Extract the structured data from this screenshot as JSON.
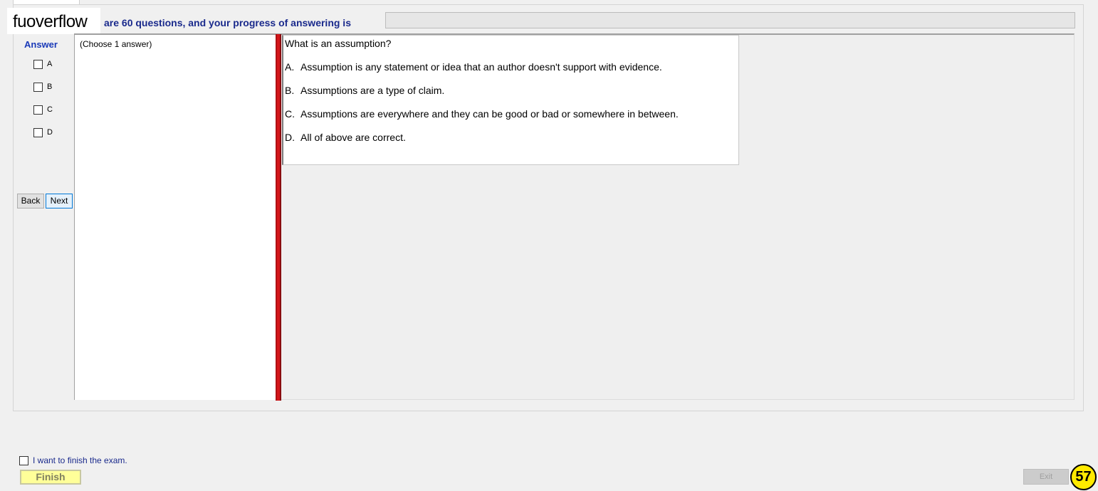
{
  "brand": {
    "text": "fuoverflow"
  },
  "header": {
    "progress_text": "are 60 questions, and your progress of answering is"
  },
  "progress": {
    "value": 0
  },
  "answer_panel": {
    "heading": "Answer",
    "options": [
      {
        "letter": "A",
        "checked": false
      },
      {
        "letter": "B",
        "checked": false
      },
      {
        "letter": "C",
        "checked": false
      },
      {
        "letter": "D",
        "checked": false
      }
    ],
    "back_label": "Back",
    "next_label": "Next"
  },
  "instruction": {
    "text": "(Choose 1 answer)"
  },
  "question": {
    "text": "What is an assumption?",
    "choices": [
      {
        "letter": "A.",
        "text": "Assumption is any statement or idea that an author doesn't support with evidence."
      },
      {
        "letter": "B.",
        "text": "Assumptions are a type of claim."
      },
      {
        "letter": "C.",
        "text": "Assumptions are everywhere and they can be good or bad or somewhere in between."
      },
      {
        "letter": "D.",
        "text": "All of above are correct."
      }
    ]
  },
  "footer": {
    "finish_check_label": "I want to finish the exam.",
    "finish_label": "Finish",
    "exit_label": "Exit",
    "badge": "57"
  },
  "colors": {
    "heading_blue": "#1a2a8c",
    "answer_blue": "#1a3ab8",
    "splitter_red": "#d4161a",
    "finish_yellow": "#ffff99",
    "badge_yellow": "#ffea00"
  }
}
